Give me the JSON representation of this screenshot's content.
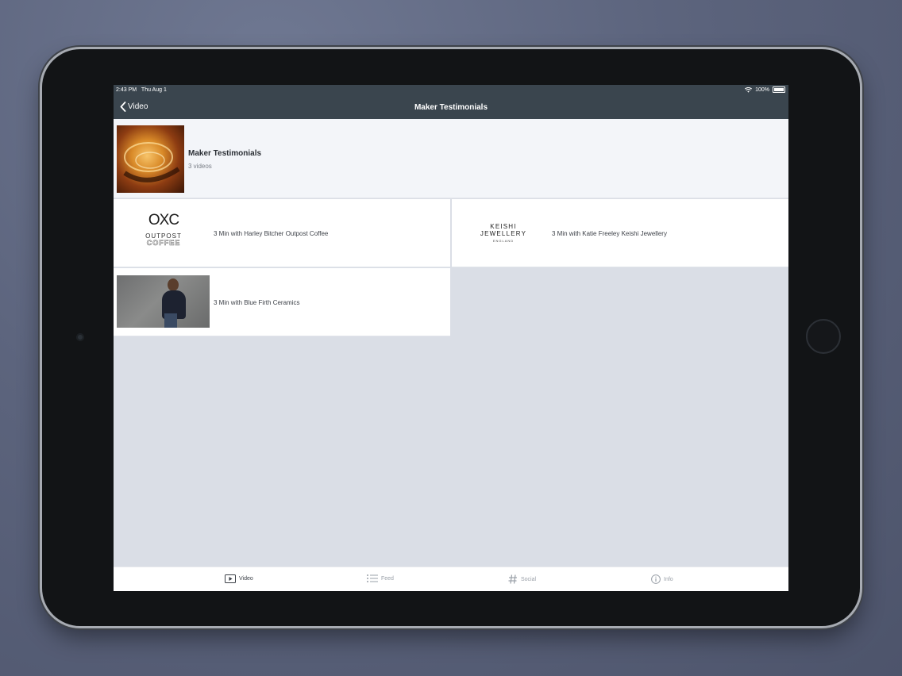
{
  "status": {
    "time": "2:43 PM",
    "date": "Thu Aug 1",
    "battery": "100%"
  },
  "nav": {
    "back_label": "Video",
    "title": "Maker Testimonials"
  },
  "collection": {
    "title": "Maker Testimonials",
    "count": "3 videos"
  },
  "videos": [
    {
      "title": "3 Min with Harley Bitcher Outpost Coffee",
      "logo": {
        "mark": "OXC",
        "line1": "OUTPOST",
        "line2": "COFFEE"
      }
    },
    {
      "title": "3 Min with Katie Freeley Keishi Jewellery",
      "logo": {
        "name": "KEISHI JEWELLERY",
        "sub": "ENGLAND"
      }
    },
    {
      "title": "3 Min with Blue Firth Ceramics"
    }
  ],
  "tabs": [
    {
      "label": "Video",
      "icon": "video-icon",
      "active": true
    },
    {
      "label": "Feed",
      "icon": "list-icon",
      "active": false
    },
    {
      "label": "Social",
      "icon": "hashtag-icon",
      "active": false
    },
    {
      "label": "Info",
      "icon": "info-icon",
      "active": false
    }
  ],
  "colors": {
    "nav_bg": "#3a454e",
    "screen_bg": "#dadee6",
    "card_bg": "#ffffff",
    "header_bg": "#f3f5f9"
  }
}
